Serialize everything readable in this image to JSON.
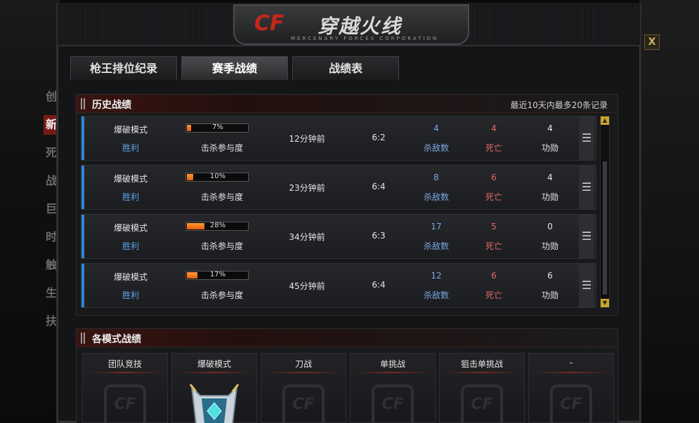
{
  "window": {
    "logo_mark": "CF",
    "logo_title": "穿越火线",
    "logo_sub": "MERCENARY FORCES CORPORATION",
    "close_label": "X"
  },
  "side_menu": [
    "创",
    "新",
    "死",
    "战",
    "巨",
    "时",
    "触",
    "生",
    "扶"
  ],
  "tabs": [
    {
      "label": "枪王排位纪录",
      "active": false
    },
    {
      "label": "赛季战绩",
      "active": true
    },
    {
      "label": "战绩表",
      "active": false
    }
  ],
  "history": {
    "title": "历史战绩",
    "note": "最近10天内最多20条记录",
    "rows": [
      {
        "mode": "爆破模式",
        "result": "胜利",
        "participation_pct": 7,
        "participation_text": "7%",
        "participation_label": "击杀参与度",
        "time": "12分钟前",
        "score": "6:2",
        "kills": "4",
        "kills_label": "杀敌数",
        "deaths": "4",
        "deaths_label": "死亡",
        "merit": "4",
        "merit_label": "功勋"
      },
      {
        "mode": "爆破模式",
        "result": "胜利",
        "participation_pct": 10,
        "participation_text": "10%",
        "participation_label": "击杀参与度",
        "time": "23分钟前",
        "score": "6:4",
        "kills": "8",
        "kills_label": "杀敌数",
        "deaths": "6",
        "deaths_label": "死亡",
        "merit": "4",
        "merit_label": "功勋"
      },
      {
        "mode": "爆破模式",
        "result": "胜利",
        "participation_pct": 28,
        "participation_text": "28%",
        "participation_label": "击杀参与度",
        "time": "34分钟前",
        "score": "6:3",
        "kills": "17",
        "kills_label": "杀敌数",
        "deaths": "5",
        "deaths_label": "死亡",
        "merit": "0",
        "merit_label": "功勋"
      },
      {
        "mode": "爆破模式",
        "result": "胜利",
        "participation_pct": 17,
        "participation_text": "17%",
        "participation_label": "击杀参与度",
        "time": "45分钟前",
        "score": "6:4",
        "kills": "12",
        "kills_label": "杀敌数",
        "deaths": "6",
        "deaths_label": "死亡",
        "merit": "6",
        "merit_label": "功勋"
      }
    ]
  },
  "modes": {
    "title": "各模式战绩",
    "cards": [
      "团队竞技",
      "爆破模式",
      "刀战",
      "单挑战",
      "狙击单挑战",
      "-"
    ]
  },
  "colors": {
    "accent_blue": "#2f86d6",
    "progress_orange": "#e65d0c",
    "deaths_red": "#e06a6a",
    "kills_blue": "#7aa7e4",
    "scroll_gold": "#c8a42a"
  }
}
